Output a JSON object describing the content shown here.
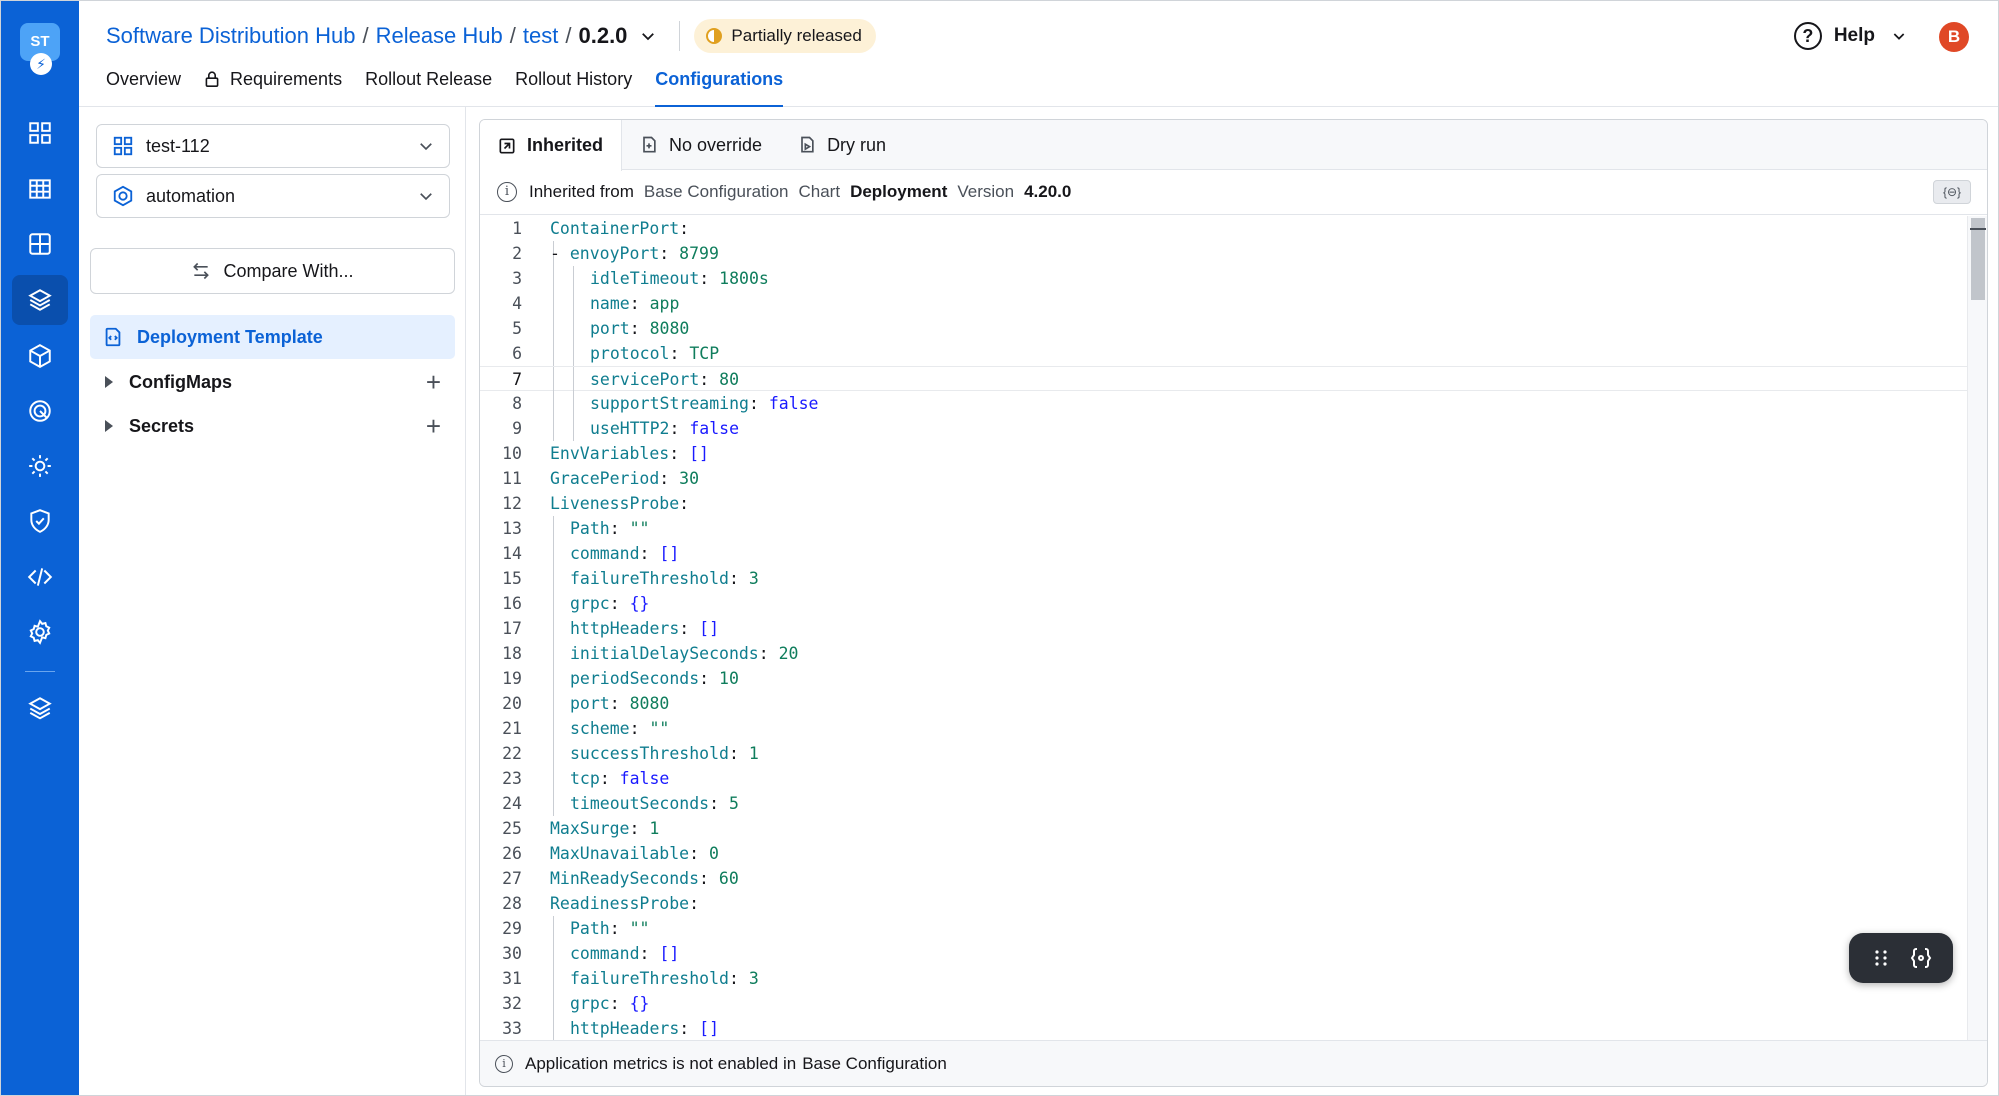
{
  "rail": {
    "logo_text": "ST",
    "items": [
      {
        "name": "rail-grid-icon"
      },
      {
        "name": "rail-table-icon"
      },
      {
        "name": "rail-apps-icon"
      },
      {
        "name": "rail-release-hub-icon"
      },
      {
        "name": "rail-cube-icon"
      },
      {
        "name": "rail-target-icon"
      },
      {
        "name": "rail-gear-icon"
      },
      {
        "name": "rail-shield-icon"
      },
      {
        "name": "rail-code-icon"
      },
      {
        "name": "rail-settings-icon"
      },
      {
        "name": "rail-layers-icon"
      }
    ]
  },
  "header": {
    "breadcrumb": {
      "root": "Software Distribution Hub",
      "sep": "/",
      "hub": "Release Hub",
      "track": "test",
      "version": "0.2.0"
    },
    "status_badge": "Partially released",
    "help_label": "Help",
    "avatar_initial": "B",
    "tabs": [
      {
        "label": "Overview"
      },
      {
        "label": "Requirements"
      },
      {
        "label": "Rollout Release"
      },
      {
        "label": "Rollout History"
      },
      {
        "label": "Configurations"
      }
    ]
  },
  "sidebar": {
    "app_select": "test-112",
    "env_select": "automation",
    "compare_label": "Compare With...",
    "deployment_template": "Deployment Template",
    "configmaps": "ConfigMaps",
    "secrets": "Secrets",
    "plus": "+"
  },
  "editor": {
    "tabs": [
      {
        "label": "Inherited"
      },
      {
        "label": "No override"
      },
      {
        "label": "Dry run"
      }
    ],
    "info": {
      "prefix": "Inherited from",
      "source": "Base Configuration",
      "chart_label": "Chart",
      "chart_value": "Deployment",
      "version_label": "Version",
      "version_value": "4.20.0"
    },
    "lines": [
      {
        "n": "1",
        "indent": 0,
        "dash": false,
        "key": "ContainerPort",
        "val": ""
      },
      {
        "n": "2",
        "indent": 1,
        "dash": true,
        "key": "envoyPort",
        "val": "8799"
      },
      {
        "n": "3",
        "indent": 2,
        "dash": false,
        "key": "idleTimeout",
        "val": "1800s"
      },
      {
        "n": "4",
        "indent": 2,
        "dash": false,
        "key": "name",
        "val": "app"
      },
      {
        "n": "5",
        "indent": 2,
        "dash": false,
        "key": "port",
        "val": "8080"
      },
      {
        "n": "6",
        "indent": 2,
        "dash": false,
        "key": "protocol",
        "val": "TCP"
      },
      {
        "n": "7",
        "indent": 2,
        "dash": false,
        "key": "servicePort",
        "val": "80"
      },
      {
        "n": "8",
        "indent": 2,
        "dash": false,
        "key": "supportStreaming",
        "val": "false"
      },
      {
        "n": "9",
        "indent": 2,
        "dash": false,
        "key": "useHTTP2",
        "val": "false"
      },
      {
        "n": "10",
        "indent": 0,
        "dash": false,
        "key": "EnvVariables",
        "val": "[]"
      },
      {
        "n": "11",
        "indent": 0,
        "dash": false,
        "key": "GracePeriod",
        "val": "30"
      },
      {
        "n": "12",
        "indent": 0,
        "dash": false,
        "key": "LivenessProbe",
        "val": ""
      },
      {
        "n": "13",
        "indent": 1,
        "dash": false,
        "key": "Path",
        "val": "\"\""
      },
      {
        "n": "14",
        "indent": 1,
        "dash": false,
        "key": "command",
        "val": "[]"
      },
      {
        "n": "15",
        "indent": 1,
        "dash": false,
        "key": "failureThreshold",
        "val": "3"
      },
      {
        "n": "16",
        "indent": 1,
        "dash": false,
        "key": "grpc",
        "val": "{}"
      },
      {
        "n": "17",
        "indent": 1,
        "dash": false,
        "key": "httpHeaders",
        "val": "[]"
      },
      {
        "n": "18",
        "indent": 1,
        "dash": false,
        "key": "initialDelaySeconds",
        "val": "20"
      },
      {
        "n": "19",
        "indent": 1,
        "dash": false,
        "key": "periodSeconds",
        "val": "10"
      },
      {
        "n": "20",
        "indent": 1,
        "dash": false,
        "key": "port",
        "val": "8080"
      },
      {
        "n": "21",
        "indent": 1,
        "dash": false,
        "key": "scheme",
        "val": "\"\""
      },
      {
        "n": "22",
        "indent": 1,
        "dash": false,
        "key": "successThreshold",
        "val": "1"
      },
      {
        "n": "23",
        "indent": 1,
        "dash": false,
        "key": "tcp",
        "val": "false"
      },
      {
        "n": "24",
        "indent": 1,
        "dash": false,
        "key": "timeoutSeconds",
        "val": "5"
      },
      {
        "n": "25",
        "indent": 0,
        "dash": false,
        "key": "MaxSurge",
        "val": "1"
      },
      {
        "n": "26",
        "indent": 0,
        "dash": false,
        "key": "MaxUnavailable",
        "val": "0"
      },
      {
        "n": "27",
        "indent": 0,
        "dash": false,
        "key": "MinReadySeconds",
        "val": "60"
      },
      {
        "n": "28",
        "indent": 0,
        "dash": false,
        "key": "ReadinessProbe",
        "val": ""
      },
      {
        "n": "29",
        "indent": 1,
        "dash": false,
        "key": "Path",
        "val": "\"\""
      },
      {
        "n": "30",
        "indent": 1,
        "dash": false,
        "key": "command",
        "val": "[]"
      },
      {
        "n": "31",
        "indent": 1,
        "dash": false,
        "key": "failureThreshold",
        "val": "3"
      },
      {
        "n": "32",
        "indent": 1,
        "dash": false,
        "key": "grpc",
        "val": "{}"
      },
      {
        "n": "33",
        "indent": 1,
        "dash": false,
        "key": "httpHeaders",
        "val": "[]"
      }
    ],
    "current_line": "7",
    "footer": {
      "text": "Application metrics is not enabled in",
      "source": "Base Configuration"
    }
  },
  "colors": {
    "rail": "#0b62d6",
    "accent": "#0b62d6",
    "badge_bg": "#fdf1d7",
    "yaml_key": "#0f7d8f",
    "yaml_number": "#0f7d5c",
    "yaml_bool": "#1a1aff"
  }
}
